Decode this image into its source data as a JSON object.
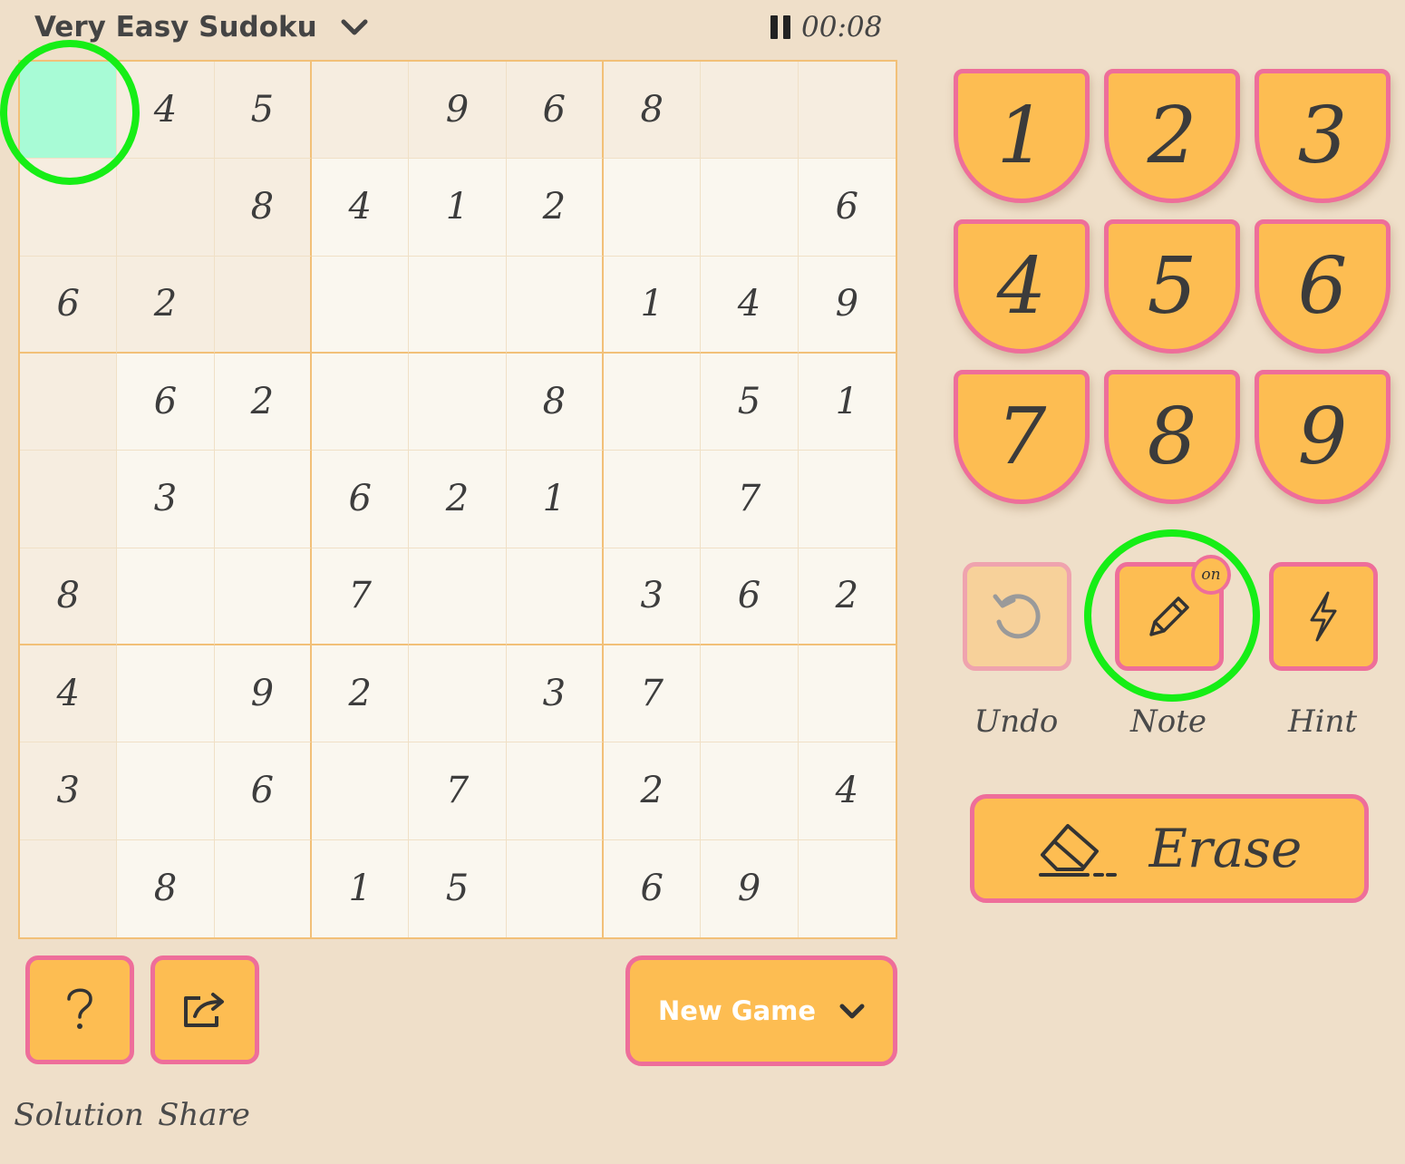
{
  "header": {
    "title": "Very Easy Sudoku",
    "timer": "00:08"
  },
  "board": {
    "rows": [
      [
        "",
        "4",
        "5",
        "",
        "9",
        "6",
        "8",
        "",
        ""
      ],
      [
        "",
        "",
        "8",
        "4",
        "1",
        "2",
        "",
        "",
        "6"
      ],
      [
        "6",
        "2",
        "",
        "",
        "",
        "",
        "1",
        "4",
        "9"
      ],
      [
        "",
        "6",
        "2",
        "",
        "",
        "8",
        "",
        "5",
        "1"
      ],
      [
        "",
        "3",
        "",
        "6",
        "2",
        "1",
        "",
        "7",
        ""
      ],
      [
        "8",
        "",
        "",
        "7",
        "",
        "",
        "3",
        "6",
        "2"
      ],
      [
        "4",
        "",
        "9",
        "2",
        "",
        "3",
        "7",
        "",
        ""
      ],
      [
        "3",
        "",
        "6",
        "",
        "7",
        "",
        "2",
        "",
        "4"
      ],
      [
        "",
        "8",
        "",
        "1",
        "5",
        "",
        "6",
        "9",
        ""
      ]
    ],
    "selected": {
      "row": 1,
      "col": 1
    }
  },
  "numpad": [
    "1",
    "2",
    "3",
    "4",
    "5",
    "6",
    "7",
    "8",
    "9"
  ],
  "tools": {
    "undo_label": "Undo",
    "note_label": "Note",
    "note_badge": "on",
    "hint_label": "Hint",
    "erase_label": "Erase"
  },
  "bottom": {
    "solution_label": "Solution",
    "share_label": "Share",
    "new_game_label": "New Game"
  },
  "colors": {
    "background": "#efdfc9",
    "button_fill": "#fdbd52",
    "button_border": "#ee6e9a",
    "selected_cell": "#a8fbd6",
    "highlight_ring": "#16ee16"
  }
}
